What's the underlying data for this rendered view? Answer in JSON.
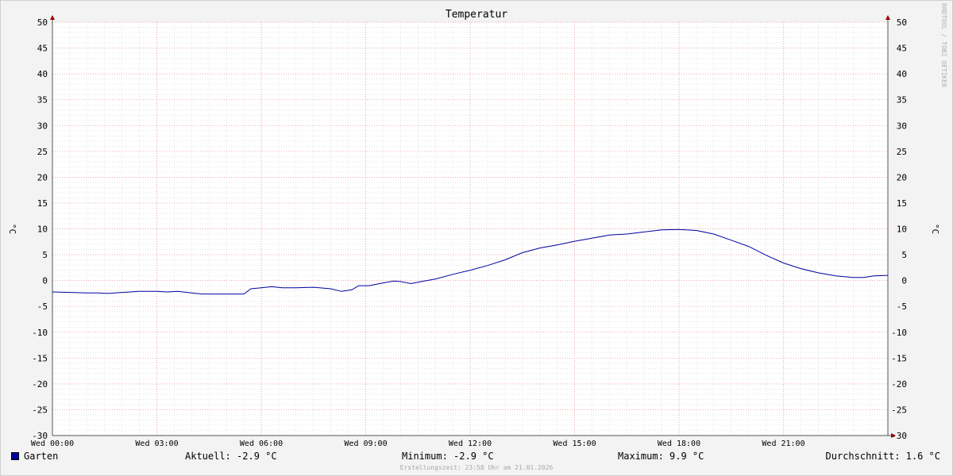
{
  "chart_data": {
    "type": "line",
    "title": "Temperatur",
    "ylabel": "°C",
    "ylim": [
      -30,
      50
    ],
    "y_ticks": [
      50,
      45,
      40,
      35,
      30,
      25,
      20,
      15,
      10,
      5,
      0,
      -5,
      -10,
      -15,
      -20,
      -25,
      -30
    ],
    "xlim_hours": [
      0,
      24
    ],
    "x_tick_labels": [
      "Wed 00:00",
      "Wed 03:00",
      "Wed 06:00",
      "Wed 09:00",
      "Wed 12:00",
      "Wed 15:00",
      "Wed 18:00",
      "Wed 21:00"
    ],
    "grid": true,
    "series": [
      {
        "name": "Garten",
        "color": "#0000a0",
        "points": [
          [
            0.0,
            -2.2
          ],
          [
            0.5,
            -2.3
          ],
          [
            1.0,
            -2.4
          ],
          [
            1.3,
            -2.4
          ],
          [
            1.6,
            -2.5
          ],
          [
            2.0,
            -2.3
          ],
          [
            2.5,
            -2.1
          ],
          [
            3.0,
            -2.1
          ],
          [
            3.3,
            -2.2
          ],
          [
            3.6,
            -2.1
          ],
          [
            4.0,
            -2.4
          ],
          [
            4.3,
            -2.6
          ],
          [
            4.6,
            -2.6
          ],
          [
            5.0,
            -2.6
          ],
          [
            5.5,
            -2.6
          ],
          [
            5.7,
            -1.6
          ],
          [
            6.0,
            -1.4
          ],
          [
            6.3,
            -1.2
          ],
          [
            6.6,
            -1.4
          ],
          [
            7.0,
            -1.4
          ],
          [
            7.5,
            -1.3
          ],
          [
            8.0,
            -1.6
          ],
          [
            8.3,
            -2.1
          ],
          [
            8.6,
            -1.8
          ],
          [
            8.8,
            -1.0
          ],
          [
            9.1,
            -1.0
          ],
          [
            9.4,
            -0.6
          ],
          [
            9.8,
            -0.1
          ],
          [
            10.0,
            -0.2
          ],
          [
            10.3,
            -0.6
          ],
          [
            10.6,
            -0.2
          ],
          [
            11.0,
            0.3
          ],
          [
            11.5,
            1.2
          ],
          [
            12.0,
            2.0
          ],
          [
            12.5,
            2.9
          ],
          [
            13.0,
            4.0
          ],
          [
            13.5,
            5.4
          ],
          [
            14.0,
            6.3
          ],
          [
            14.5,
            6.9
          ],
          [
            15.0,
            7.6
          ],
          [
            15.5,
            8.2
          ],
          [
            16.0,
            8.8
          ],
          [
            16.5,
            9.0
          ],
          [
            17.0,
            9.4
          ],
          [
            17.5,
            9.8
          ],
          [
            18.0,
            9.9
          ],
          [
            18.5,
            9.7
          ],
          [
            19.0,
            9.0
          ],
          [
            19.5,
            7.8
          ],
          [
            20.0,
            6.6
          ],
          [
            20.5,
            4.9
          ],
          [
            21.0,
            3.4
          ],
          [
            21.5,
            2.3
          ],
          [
            22.0,
            1.5
          ],
          [
            22.5,
            0.9
          ],
          [
            23.0,
            0.6
          ],
          [
            23.3,
            0.6
          ],
          [
            23.6,
            0.9
          ],
          [
            24.0,
            1.0
          ]
        ]
      }
    ]
  },
  "legend": {
    "series_name": "Garten",
    "current": "Aktuell: -2.9 °C",
    "minimum": "Minimum: -2.9 °C",
    "maximum": "Maximum: 9.9 °C",
    "average": "Durchschnitt: 1.6 °C"
  },
  "footer": "Erstellungszeit: 23:58 Uhr am 21.01.2026",
  "watermark": "RRDTOOL / TOBI OETIKER"
}
